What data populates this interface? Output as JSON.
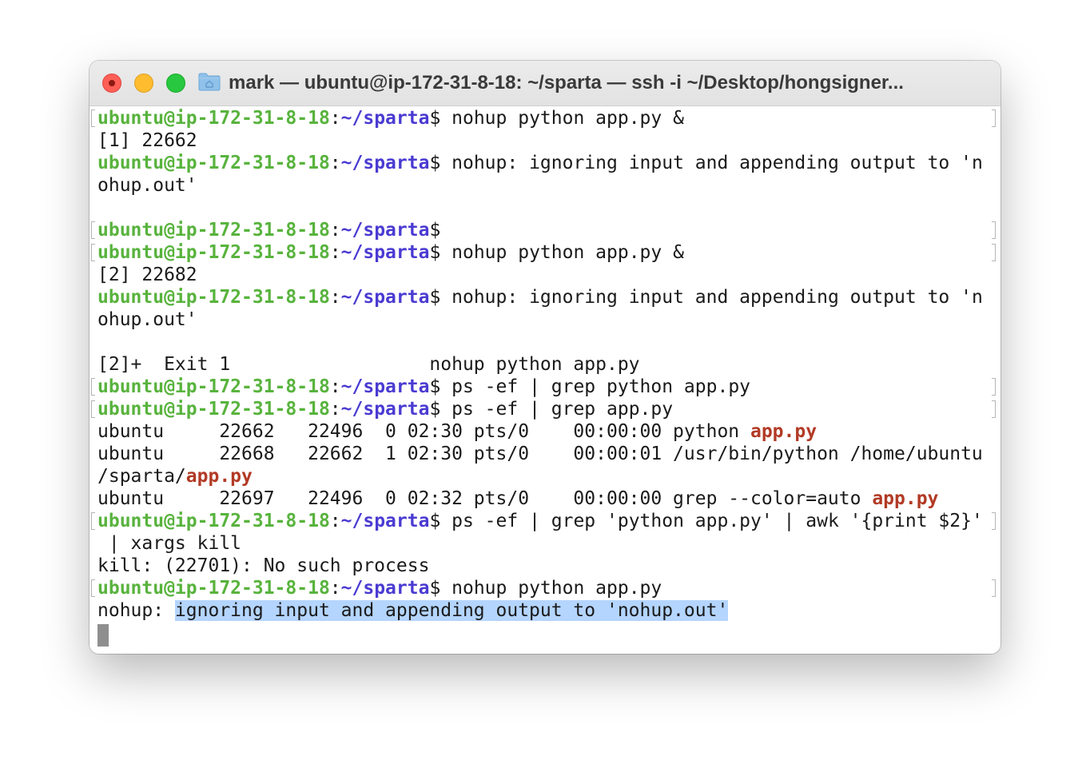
{
  "window": {
    "title": "mark — ubuntu@ip-172-31-8-18: ~/sparta — ssh -i ~/Desktop/hongsigner..."
  },
  "colors": {
    "prompt_user": "#58b33d",
    "prompt_path": "#4a3bd2",
    "grep_match": "#b23a25",
    "selection": "#b4d5fe"
  },
  "prompt": {
    "user_host": "ubuntu@ip-172-31-8-18",
    "sep": ":",
    "path": "~/sparta",
    "dollar": "$"
  },
  "terminal": {
    "cmd_1": " nohup python app.py &",
    "out_2": "[1] 22662",
    "cmd_3": " nohup: ignoring input and appending output to 'n",
    "out_4": "ohup.out'",
    "cmd_6": "",
    "cmd_7": " nohup python app.py &",
    "out_8": "[2] 22682",
    "cmd_9": " nohup: ignoring input and appending output to 'n",
    "out_10": "ohup.out'",
    "out_12": "[2]+  Exit 1                  nohup python app.py",
    "cmd_13": " ps -ef | grep python app.py",
    "cmd_14": " ps -ef | grep app.py",
    "ps_1": {
      "pre": "ubuntu     22662   22496  0 02:30 pts/0    00:00:00 python ",
      "match": "app.py",
      "post": ""
    },
    "ps_2a": "ubuntu     22668   22662  1 02:30 pts/0    00:00:01 /usr/bin/python /home/ubuntu",
    "ps_2b": {
      "pre": "/sparta/",
      "match": "app.py",
      "post": ""
    },
    "ps_3": {
      "pre": "ubuntu     22697   22496  0 02:32 pts/0    00:00:00 grep --color=auto ",
      "match": "app.py",
      "post": ""
    },
    "cmd_19": " ps -ef | grep 'python app.py' | awk '{print $2}'",
    "out_20": " | xargs kill",
    "out_21": "kill: (22701): No such process",
    "cmd_22": " nohup python app.py",
    "out_23": {
      "pre": "nohup: ",
      "selected": "ignoring input and appending output to 'nohup.out'"
    }
  }
}
